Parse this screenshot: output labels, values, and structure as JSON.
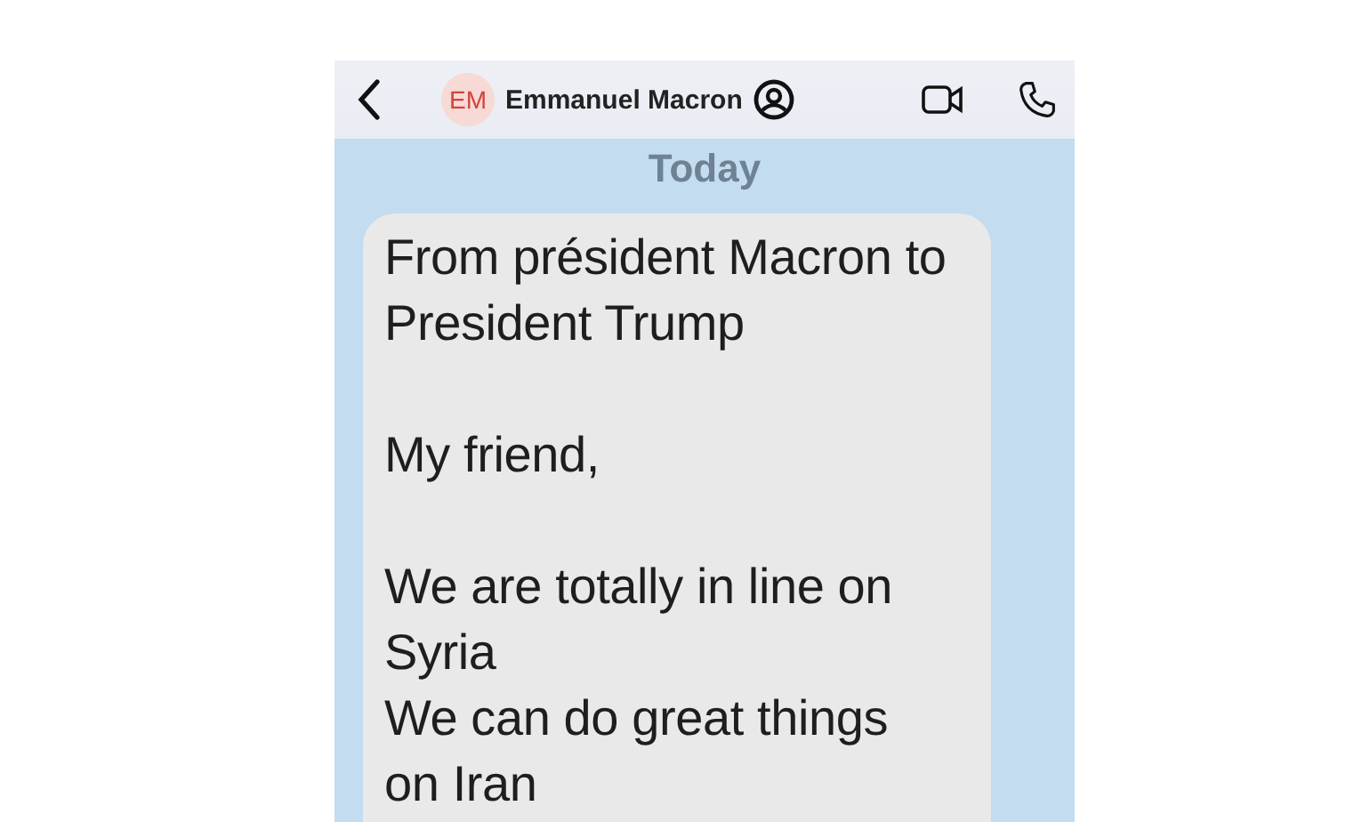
{
  "header": {
    "avatar_initials": "EM",
    "contact_name": "Emmanuel Macron"
  },
  "date_label": "Today",
  "message": {
    "paragraphs": [
      {
        "lines": [
          "From président Macron to President Trump"
        ]
      },
      {
        "lines": [
          "My friend,"
        ]
      },
      {
        "lines": [
          "We are totally in line on Syria",
          "We can do great things on Iran"
        ]
      }
    ]
  }
}
